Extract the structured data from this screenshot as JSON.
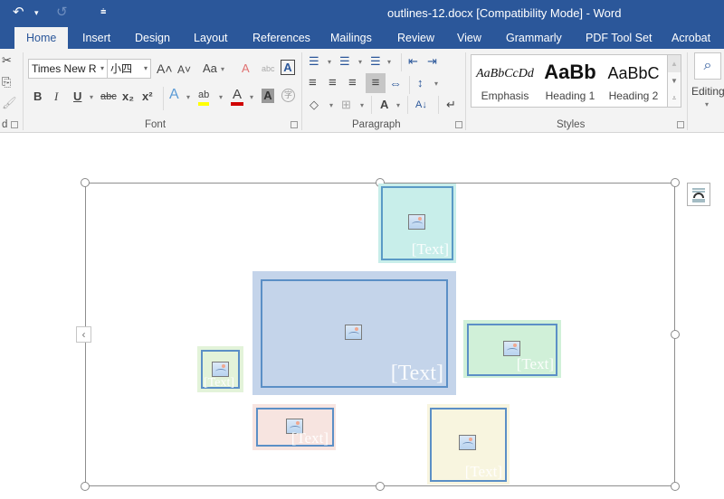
{
  "window": {
    "title": "outlines-12.docx [Compatibility Mode] - Word",
    "qat": {
      "undo_icon": "↶",
      "undo_dd": "▾",
      "redo_icon": "↺",
      "customize_icon": "⩧"
    }
  },
  "tabs": [
    {
      "label": "Home",
      "active": true
    },
    {
      "label": "Insert"
    },
    {
      "label": "Design"
    },
    {
      "label": "Layout"
    },
    {
      "label": "References"
    },
    {
      "label": "Mailings"
    },
    {
      "label": "Review"
    },
    {
      "label": "View"
    },
    {
      "label": "Grammarly"
    },
    {
      "label": "PDF Tool Set"
    },
    {
      "label": "Acrobat"
    }
  ],
  "ribbon": {
    "clipboard": {
      "label_partial": "d",
      "cut_icon": "✂",
      "copy_icon": "⎘",
      "format_painter_icon": "🖌"
    },
    "font": {
      "label": "Font",
      "font_name": "Times New R",
      "font_size": "小四",
      "grow_icon": "A˄",
      "shrink_icon": "A˅",
      "change_case": "Aa",
      "clear_format_icon": "A",
      "text_effects_icon": "abc",
      "char_border_icon": "A",
      "bold": "B",
      "italic": "I",
      "underline": "U",
      "strikethrough": "abc",
      "subscript": "x₂",
      "superscript": "x²",
      "text_effect2": "A",
      "highlight": "ab",
      "highlight_color": "#ffff00",
      "font_color": "A",
      "font_color_value": "#d00000",
      "char_shading": "A",
      "enclose_char": "字"
    },
    "paragraph": {
      "label": "Paragraph",
      "bullets": "☰",
      "numbering": "☰",
      "multilevel": "☰",
      "decrease_indent": "⇤",
      "increase_indent": "⇥",
      "align_left": "≡",
      "center": "≡",
      "align_right": "≡",
      "justify": "≡",
      "distributed": "⇔",
      "line_spacing": "↕",
      "shading": "◇",
      "borders": "⊞",
      "asian_layout": "A",
      "sort": "A↓",
      "show_marks": "↵"
    },
    "styles": {
      "label": "Styles",
      "items": [
        {
          "sample": "AaBbCcDd",
          "name": "Emphasis"
        },
        {
          "sample": "AaBb",
          "name": "Heading 1"
        },
        {
          "sample": "AaBbC",
          "name": "Heading 2"
        }
      ]
    },
    "editing": {
      "label": "Editing",
      "search_icon": "⌕"
    }
  },
  "canvas": {
    "shapes": [
      {
        "id": "top",
        "text": "[Text]",
        "fill": "#c8eeea"
      },
      {
        "id": "center",
        "text": "[Text]",
        "fill": "#c4d4ea"
      },
      {
        "id": "right",
        "text": "[Text]",
        "fill": "#d0f0d8"
      },
      {
        "id": "left",
        "text": "[Text]",
        "fill": "#e3f3d9"
      },
      {
        "id": "bottom-left",
        "text": "[Text]",
        "fill": "#f7e4e0"
      },
      {
        "id": "bottom-right",
        "text": "[Text]",
        "fill": "#f8f5df"
      }
    ],
    "collapse_icon": "‹",
    "layout_options_icon": "layout-options"
  }
}
